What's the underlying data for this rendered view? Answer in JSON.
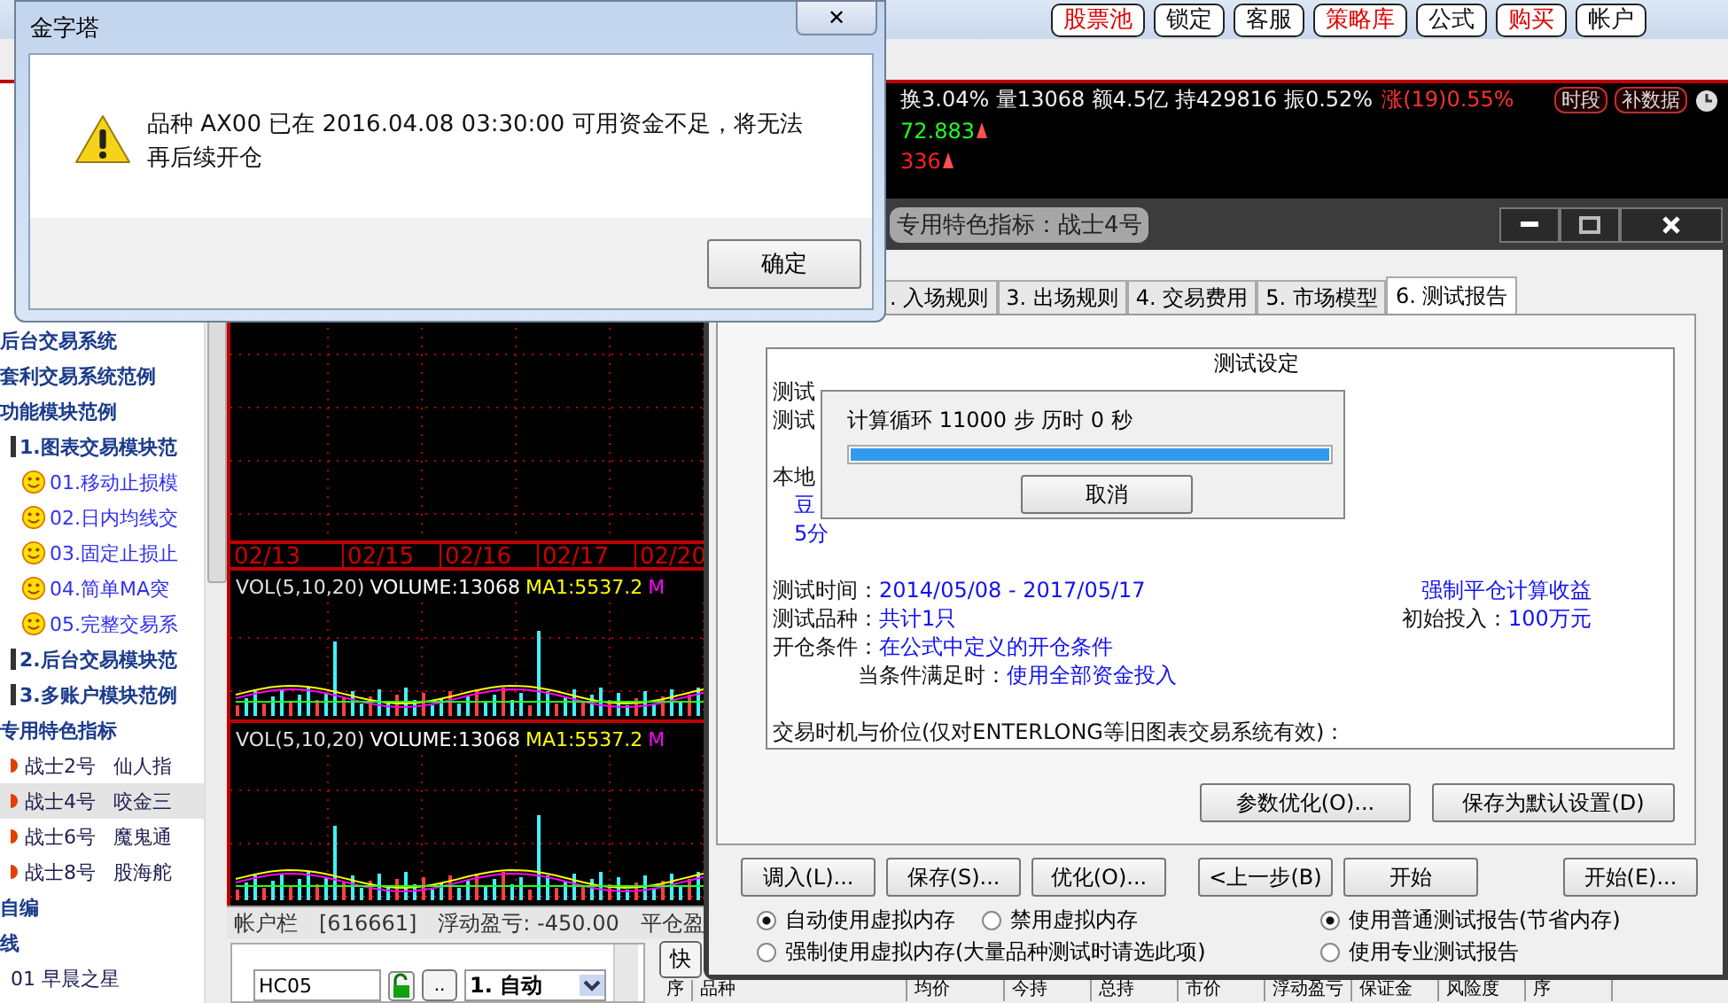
{
  "toolbar": {
    "buttons": [
      {
        "label": "股票池",
        "highlight": true
      },
      {
        "label": "锁定",
        "highlight": false
      },
      {
        "label": "客服",
        "highlight": false
      },
      {
        "label": "策略库",
        "highlight": true
      },
      {
        "label": "公式",
        "highlight": false
      },
      {
        "label": "购买",
        "highlight": true
      },
      {
        "label": "帐户",
        "highlight": false
      }
    ]
  },
  "sidebar": {
    "items": [
      {
        "label": "后台交易系统",
        "kind": "heading",
        "selected": false
      },
      {
        "label": "套利交易系统范例",
        "kind": "heading",
        "selected": false
      },
      {
        "label": "功能模块范例",
        "kind": "heading",
        "selected": false,
        "children": [
          {
            "label": "1.图表交易模块范",
            "kind": "group",
            "selected": false,
            "children": [
              {
                "label": "01.移动止损模",
                "kind": "system",
                "selected": false
              },
              {
                "label": "02.日内均线交",
                "kind": "system",
                "selected": false
              },
              {
                "label": "03.固定止损止",
                "kind": "system",
                "selected": false
              },
              {
                "label": "04.简单MA突",
                "kind": "system",
                "selected": false
              },
              {
                "label": "05.完整交易系",
                "kind": "system",
                "selected": false
              }
            ]
          },
          {
            "label": "2.后台交易模块范",
            "kind": "group",
            "selected": false
          },
          {
            "label": "3.多账户模块范例",
            "kind": "group",
            "selected": false
          }
        ]
      },
      {
        "label": "专用特色指标",
        "kind": "heading",
        "selected": false,
        "children": [
          {
            "label": "战士2号",
            "note": "仙人指",
            "kind": "indicator",
            "selected": false
          },
          {
            "label": "战士4号",
            "note": "咬金三",
            "kind": "indicator",
            "selected": true
          },
          {
            "label": "战士6号",
            "note": "魔鬼通",
            "kind": "indicator",
            "selected": false
          },
          {
            "label": "战士8号",
            "note": "股海舵",
            "kind": "indicator",
            "selected": false
          }
        ]
      },
      {
        "label": "自编",
        "kind": "heading",
        "selected": false
      },
      {
        "label": "线",
        "kind": "heading",
        "selected": false,
        "children": [
          {
            "label": "01 早晨之星",
            "kind": "plain",
            "selected": false
          }
        ]
      }
    ]
  },
  "chart": {
    "ticker": {
      "stats": "换3.04% 量13068 额4.5亿 持429816 振0.52%",
      "change": "涨(19)0.55%",
      "buttons": [
        "时段",
        "补数据"
      ],
      "line_2": "72.883",
      "line_3": "336"
    },
    "dates": [
      "02/13",
      "02/15",
      "02/16",
      "02/17",
      "02/20"
    ],
    "volume_panels": [
      {
        "legend": [
          {
            "text": "VOL(5,10,20)",
            "color": "#e0e0e0"
          },
          {
            "text": "VOLUME:13068",
            "color": "#ffffff"
          },
          {
            "text": "MA1:5537.2",
            "color": "#ffff00"
          },
          {
            "text": "M",
            "color": "#ff00ff"
          }
        ]
      },
      {
        "legend": [
          {
            "text": "VOL(5,10,20)",
            "color": "#e0e0e0"
          },
          {
            "text": "VOLUME:13068",
            "color": "#ffffff"
          },
          {
            "text": "MA1:5537.2",
            "color": "#ffff00"
          },
          {
            "text": "M",
            "color": "#ff00ff"
          }
        ]
      }
    ]
  },
  "account_bar": {
    "label": "帐户栏",
    "account": "[616661]",
    "floating_pl": "浮动盈亏: -450.00",
    "closed_pl": "平仓盈"
  },
  "order_panel": {
    "symbol": "HC05",
    "browse": "..",
    "mode": "1. 自动",
    "quick_button": "快",
    "columns": [
      "序",
      "品种",
      "均价",
      "今持",
      "总持",
      "市价",
      "浮动盈亏",
      "保证金",
      "风险度",
      "序"
    ]
  },
  "backtest_dialog": {
    "title": "专用特色指标：战士4号",
    "tabs": [
      {
        "label": ". 入场规则",
        "selected": false
      },
      {
        "label": "3. 出场规则",
        "selected": false
      },
      {
        "label": "4. 交易费用",
        "selected": false
      },
      {
        "label": "5. 市场模型",
        "selected": false
      },
      {
        "label": "6. 测试报告",
        "selected": true
      }
    ],
    "report": {
      "heading": "测试设定",
      "rows": [
        {
          "left": [
            {
              "text": "测试",
              "kind": "label"
            }
          ]
        },
        {
          "left": [
            {
              "text": "测试",
              "kind": "label"
            }
          ]
        },
        {},
        {
          "left": [
            {
              "text": "本地",
              "kind": "label"
            }
          ]
        },
        {
          "left": [
            {
              "text": "豆",
              "kind": "value"
            }
          ],
          "indent": true
        },
        {
          "left": [
            {
              "text": "5分",
              "kind": "value"
            }
          ],
          "indent": true
        },
        {},
        {
          "left": [
            {
              "text": "测试时间：",
              "kind": "label"
            },
            {
              "text": "2014/05/08 - 2017/05/17",
              "kind": "value"
            }
          ],
          "right": [
            {
              "text": "强制平仓计算收益",
              "kind": "value"
            }
          ]
        },
        {
          "left": [
            {
              "text": "测试品种：",
              "kind": "label"
            },
            {
              "text": "共计1只",
              "kind": "value"
            }
          ],
          "right": [
            {
              "text": "初始投入：",
              "kind": "label"
            },
            {
              "text": "100万元",
              "kind": "value"
            }
          ]
        },
        {
          "left": [
            {
              "text": "开仓条件：",
              "kind": "label"
            },
            {
              "text": "在公式中定义的开仓条件",
              "kind": "value"
            }
          ]
        },
        {
          "left": [
            {
              "text": "当条件满足时：",
              "kind": "label"
            },
            {
              "text": "使用全部资金投入",
              "kind": "value"
            }
          ],
          "sub": true
        },
        {},
        {
          "left": [
            {
              "text": "交易时机与价位(仅对ENTERLONG等旧图表交易系统有效)：",
              "kind": "label"
            }
          ]
        }
      ]
    },
    "panel_buttons": [
      "参数优化(O)...",
      "保存为默认设置(D)"
    ],
    "action_buttons": [
      [
        "调入(L)...",
        "保存(S)...",
        "优化(O)..."
      ],
      [
        "<上一步(B)",
        "开始"
      ],
      [
        "开始(E)..."
      ]
    ],
    "memory_options": [
      {
        "label": "自动使用虚拟内存",
        "selected": true
      },
      {
        "label": "禁用虚拟内存",
        "selected": false
      },
      {
        "label": "强制使用虚拟内存(大量品种测试时请选此项)",
        "selected": false
      }
    ],
    "report_options": [
      {
        "label": "使用普通测试报告(节省内存)",
        "selected": true
      },
      {
        "label": "使用专业测试报告",
        "selected": false
      }
    ]
  },
  "progress_dialog": {
    "message": "计算循环 11000 步 历时 0 秒",
    "level": 1.0,
    "button": "取消"
  },
  "alert": {
    "title": "金字塔",
    "close": "✕",
    "message": "品种 AX00 已在 2016.04.08 03:30:00 可用资金不足，将无法再后续开仓",
    "button": "确定"
  }
}
